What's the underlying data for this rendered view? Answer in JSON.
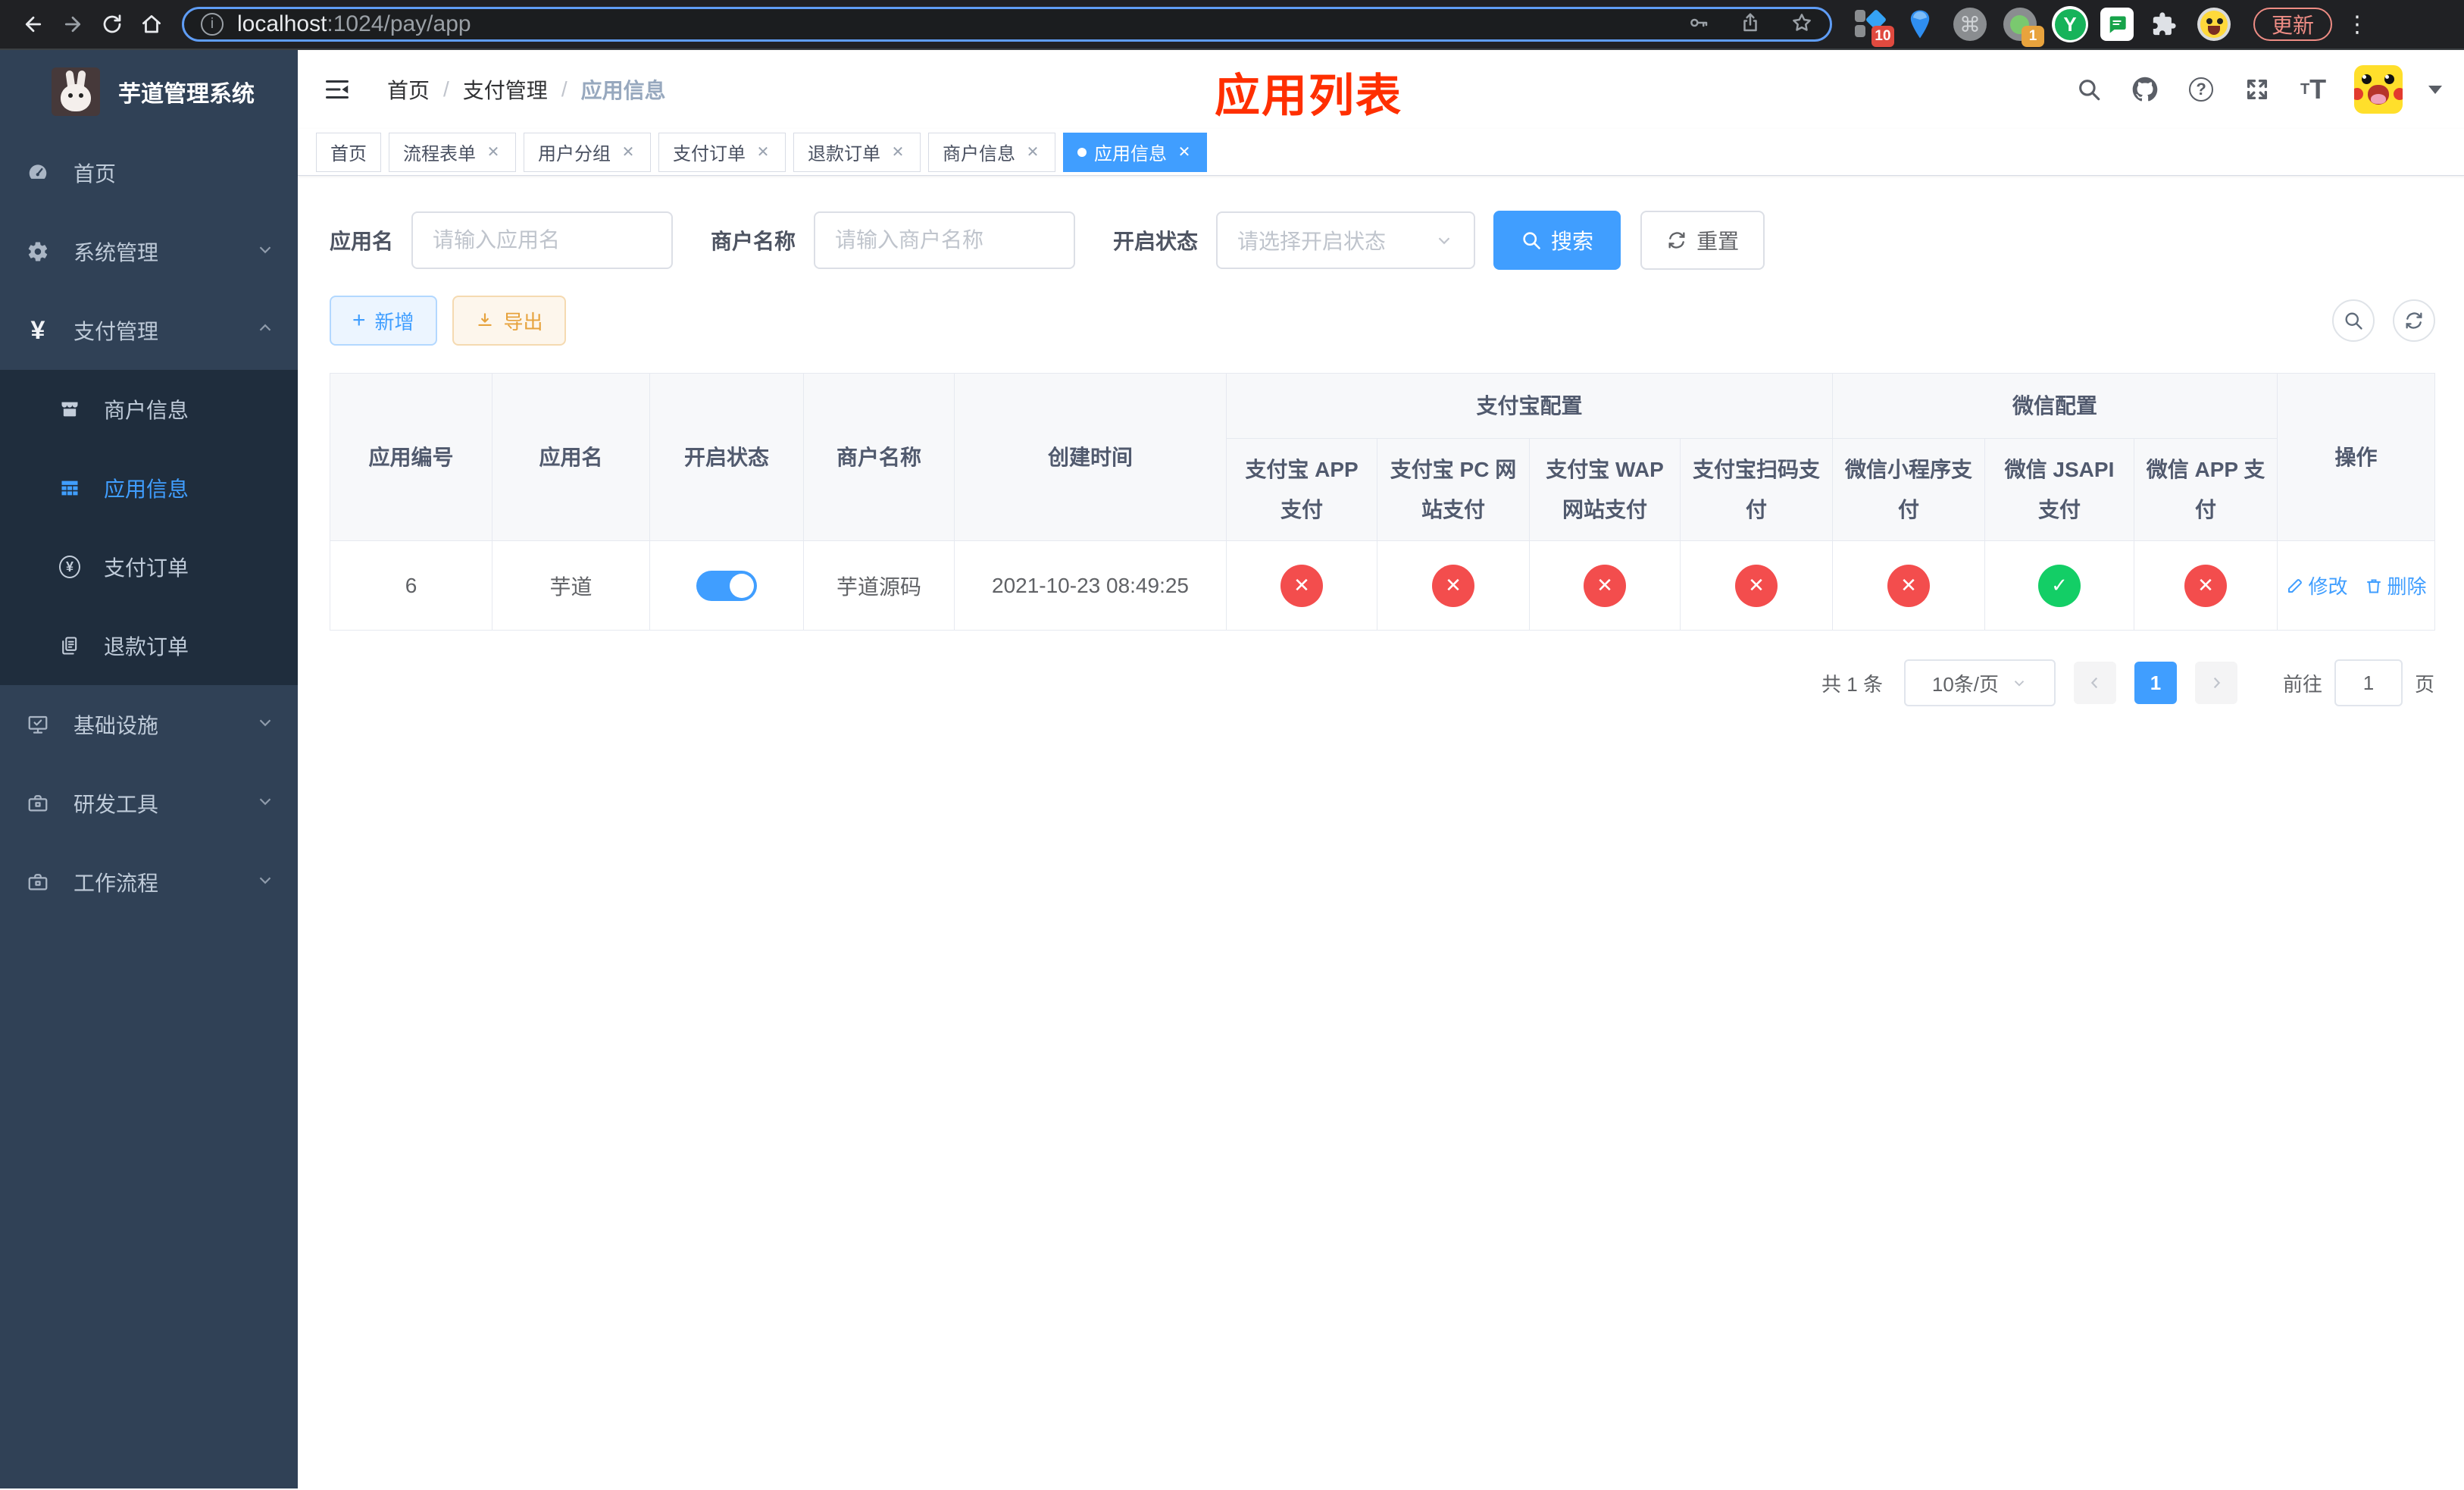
{
  "theme": {
    "accent": "#409eff",
    "danger": "#f34d4d",
    "success": "#13ce66",
    "export": "#e6a23c",
    "sidebar_bg": "#304156",
    "submenu_bg": "#1f2d3d"
  },
  "browser": {
    "url_host": "localhost",
    "url_path": ":1024/pay/app",
    "update_label": "更新",
    "ext_badge_tiles": "10",
    "ext_badge_dot": "1",
    "command_glyph": "⌘",
    "y_glyph": "Y",
    "kebab_glyph": "⋮"
  },
  "sidebar": {
    "title": "芋道管理系统",
    "items": [
      {
        "label": "首页"
      },
      {
        "label": "系统管理"
      },
      {
        "label": "支付管理",
        "children": [
          {
            "label": "商户信息"
          },
          {
            "label": "应用信息"
          },
          {
            "label": "支付订单"
          },
          {
            "label": "退款订单"
          }
        ]
      },
      {
        "label": "基础设施"
      },
      {
        "label": "研发工具"
      },
      {
        "label": "工作流程"
      }
    ],
    "yen_glyph": "¥"
  },
  "navbar": {
    "breadcrumb": [
      "首页",
      "支付管理",
      "应用信息"
    ],
    "breadcrumb_sep": "/",
    "help_glyph": "?"
  },
  "overlay_title": "应用列表",
  "tabs": [
    {
      "label": "首页"
    },
    {
      "label": "流程表单"
    },
    {
      "label": "用户分组"
    },
    {
      "label": "支付订单"
    },
    {
      "label": "退款订单"
    },
    {
      "label": "商户信息"
    },
    {
      "label": "应用信息"
    }
  ],
  "tab_close_glyph": "✕",
  "filters": {
    "app_name_label": "应用名",
    "app_name_placeholder": "请输入应用名",
    "merchant_label": "商户名称",
    "merchant_placeholder": "请输入商户名称",
    "status_label": "开启状态",
    "status_placeholder": "请选择开启状态",
    "search_label": "搜索",
    "reset_label": "重置"
  },
  "toolbar": {
    "add_label": "新增",
    "export_label": "导出",
    "plus_glyph": "+"
  },
  "table": {
    "col_id": "应用编号",
    "col_name": "应用名",
    "col_status": "开启状态",
    "col_merchant": "商户名称",
    "col_created": "创建时间",
    "group_alipay": "支付宝配置",
    "group_wechat": "微信配置",
    "col_actions": "操作",
    "alipay_cols": [
      "支付宝 APP 支付",
      "支付宝 PC 网站支付",
      "支付宝 WAP 网站支付",
      "支付宝扫码支付"
    ],
    "wechat_cols": [
      "微信小程序支付",
      "微信 JSAPI 支付",
      "微信 APP 支付"
    ],
    "rows": [
      {
        "id": "6",
        "name": "芋道",
        "enabled": true,
        "merchant": "芋道源码",
        "created": "2021-10-23 08:49:25",
        "statuses": [
          "fail",
          "fail",
          "fail",
          "fail",
          "fail",
          "pass",
          "fail"
        ],
        "edit_label": "修改",
        "delete_label": "删除"
      }
    ]
  },
  "icons": {
    "pass_glyph": "✓",
    "fail_glyph": "✕"
  },
  "pagination": {
    "total": "共 1 条",
    "page_size": "10条/页",
    "page": "1",
    "goto_label": "前往",
    "goto_value": "1",
    "page_unit": "页"
  }
}
